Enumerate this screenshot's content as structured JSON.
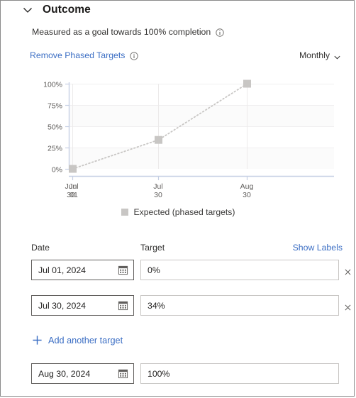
{
  "header": {
    "title": "Outcome",
    "collapse_icon": "chevron-down-icon",
    "subtitle": "Measured as a goal towards 100% completion",
    "subtitle_info_icon": "info-icon",
    "remove_link": "Remove Phased Targets",
    "remove_link_info_icon": "info-icon",
    "cadence_value": "Monthly",
    "cadence_icon": "chevron-down-icon"
  },
  "chart_data": {
    "type": "line",
    "title": "",
    "xlabel": "",
    "ylabel": "",
    "ylim": [
      0,
      100
    ],
    "ytick_labels": [
      "0%",
      "25%",
      "50%",
      "75%",
      "100%"
    ],
    "ytick_values": [
      0,
      25,
      50,
      75,
      100
    ],
    "x": [
      "Jun 30",
      "Jul 01",
      "Jul 30",
      "Aug 30"
    ],
    "xtick_labels": [
      {
        "line1": "Jun",
        "line2": "30"
      },
      {
        "line1": "Jul",
        "line2": "01"
      },
      {
        "line1": "Jul",
        "line2": "30"
      },
      {
        "line1": "Aug",
        "line2": "30"
      }
    ],
    "series": [
      {
        "name": "Expected (phased targets)",
        "style": "dotted",
        "marker": "square",
        "color": "#c8c6c4",
        "points": [
          {
            "x": "Jul 01",
            "y": 0
          },
          {
            "x": "Jul 30",
            "y": 34
          },
          {
            "x": "Aug 30",
            "y": 100
          }
        ],
        "values": [
          0,
          34,
          100
        ]
      }
    ],
    "grid": true,
    "legend_position": "bottom",
    "legend": [
      "Expected (phased targets)"
    ]
  },
  "legend": {
    "label": "Expected (phased targets)"
  },
  "table": {
    "col_date": "Date",
    "col_target": "Target",
    "show_labels_link": "Show Labels",
    "calendar_icon": "calendar-icon",
    "remove_icon": "close-icon",
    "rows": [
      {
        "date": "Jul 01, 2024",
        "target": "0%",
        "removable": true
      },
      {
        "date": "Jul 30, 2024",
        "target": "34%",
        "removable": true
      },
      {
        "date": "Aug 30, 2024",
        "target": "100%",
        "removable": false
      }
    ]
  },
  "add_target": {
    "label": "Add another target",
    "icon": "plus-icon"
  }
}
